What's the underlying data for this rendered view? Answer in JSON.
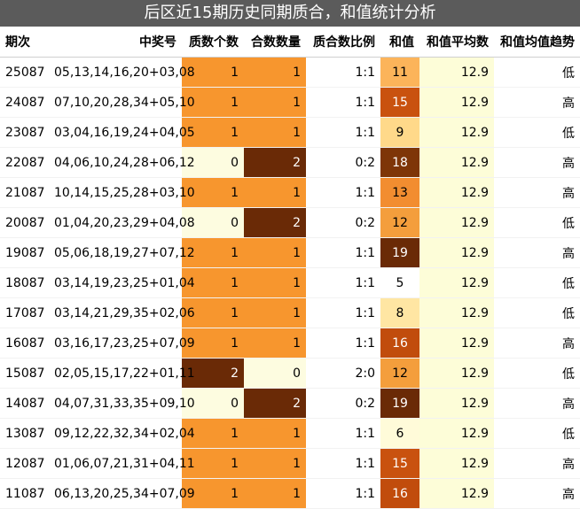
{
  "title": "后区近15期历史同期质合，和值统计分析",
  "headers": [
    "期次",
    "中奖号",
    "质数个数",
    "合数数量",
    "质合数比例",
    "和值",
    "和值平均数",
    "和值均值趋势"
  ],
  "colors": {
    "title_bg": "#5b5b5b",
    "orange": "#f7962e",
    "dark_brown": "#6a2a06",
    "cream": "#fdfce0",
    "sum_scale": {
      "5": "#ffffff",
      "6": "#fffbd9",
      "8": "#ffe6a3",
      "9": "#ffd98a",
      "11": "#fcb45a",
      "12": "#f49e3c",
      "13": "#f28d30",
      "15": "#c9520f",
      "16": "#c14c0c",
      "18": "#7e3507",
      "19": "#6a2a06"
    },
    "avg_bg": "#fdfdd8"
  },
  "rows": [
    {
      "issue": "25087",
      "numbers": "05,13,14,16,20+03,08",
      "prime": "1",
      "composite": "1",
      "ratio": "1:1",
      "sum": "11",
      "avg": "12.9",
      "trend": "低"
    },
    {
      "issue": "24087",
      "numbers": "07,10,20,28,34+05,10",
      "prime": "1",
      "composite": "1",
      "ratio": "1:1",
      "sum": "15",
      "avg": "12.9",
      "trend": "高"
    },
    {
      "issue": "23087",
      "numbers": "03,04,16,19,24+04,05",
      "prime": "1",
      "composite": "1",
      "ratio": "1:1",
      "sum": "9",
      "avg": "12.9",
      "trend": "低"
    },
    {
      "issue": "22087",
      "numbers": "04,06,10,24,28+06,12",
      "prime": "0",
      "composite": "2",
      "ratio": "0:2",
      "sum": "18",
      "avg": "12.9",
      "trend": "高"
    },
    {
      "issue": "21087",
      "numbers": "10,14,15,25,28+03,10",
      "prime": "1",
      "composite": "1",
      "ratio": "1:1",
      "sum": "13",
      "avg": "12.9",
      "trend": "高"
    },
    {
      "issue": "20087",
      "numbers": "01,04,20,23,29+04,08",
      "prime": "0",
      "composite": "2",
      "ratio": "0:2",
      "sum": "12",
      "avg": "12.9",
      "trend": "低"
    },
    {
      "issue": "19087",
      "numbers": "05,06,18,19,27+07,12",
      "prime": "1",
      "composite": "1",
      "ratio": "1:1",
      "sum": "19",
      "avg": "12.9",
      "trend": "高"
    },
    {
      "issue": "18087",
      "numbers": "03,14,19,23,25+01,04",
      "prime": "1",
      "composite": "1",
      "ratio": "1:1",
      "sum": "5",
      "avg": "12.9",
      "trend": "低"
    },
    {
      "issue": "17087",
      "numbers": "03,14,21,29,35+02,06",
      "prime": "1",
      "composite": "1",
      "ratio": "1:1",
      "sum": "8",
      "avg": "12.9",
      "trend": "低"
    },
    {
      "issue": "16087",
      "numbers": "03,16,17,23,25+07,09",
      "prime": "1",
      "composite": "1",
      "ratio": "1:1",
      "sum": "16",
      "avg": "12.9",
      "trend": "高"
    },
    {
      "issue": "15087",
      "numbers": "02,05,15,17,22+01,11",
      "prime": "2",
      "composite": "0",
      "ratio": "2:0",
      "sum": "12",
      "avg": "12.9",
      "trend": "低"
    },
    {
      "issue": "14087",
      "numbers": "04,07,31,33,35+09,10",
      "prime": "0",
      "composite": "2",
      "ratio": "0:2",
      "sum": "19",
      "avg": "12.9",
      "trend": "高"
    },
    {
      "issue": "13087",
      "numbers": "09,12,22,32,34+02,04",
      "prime": "1",
      "composite": "1",
      "ratio": "1:1",
      "sum": "6",
      "avg": "12.9",
      "trend": "低"
    },
    {
      "issue": "12087",
      "numbers": "01,06,07,21,31+04,11",
      "prime": "1",
      "composite": "1",
      "ratio": "1:1",
      "sum": "15",
      "avg": "12.9",
      "trend": "高"
    },
    {
      "issue": "11087",
      "numbers": "06,13,20,25,34+07,09",
      "prime": "1",
      "composite": "1",
      "ratio": "1:1",
      "sum": "16",
      "avg": "12.9",
      "trend": "高"
    }
  ]
}
